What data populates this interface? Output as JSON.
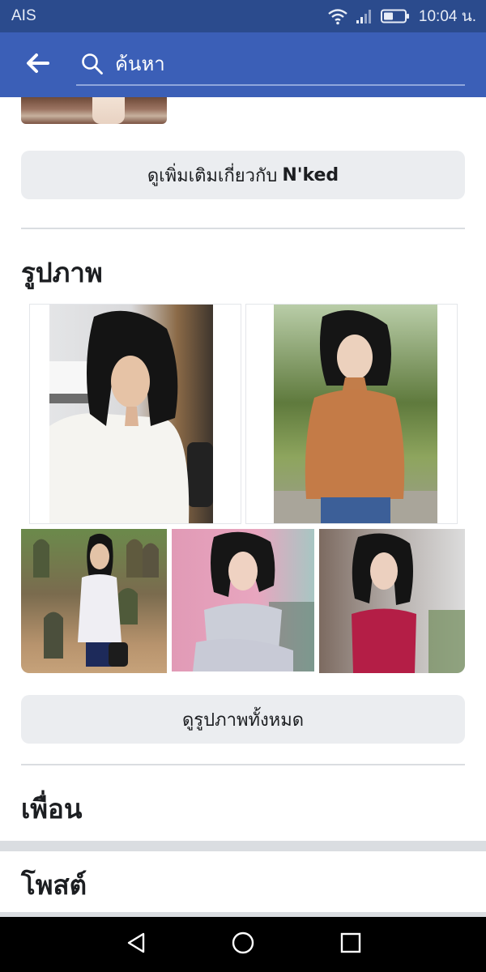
{
  "status_bar": {
    "carrier": "AIS",
    "time": "10:04 น.",
    "wifi_icon": "wifi-icon",
    "signal_icon": "signal-icon",
    "battery_icon": "battery-icon"
  },
  "app_bar": {
    "back_icon": "arrow-left-icon",
    "search_placeholder": "ค้นหา",
    "search_icon": "search-icon",
    "background_color": "#3b5fb7"
  },
  "about": {
    "see_more_prefix": "ดูเพิ่มเติมเกี่ยวกับ",
    "see_more_name": "N'ked"
  },
  "photos": {
    "title": "รูปภาพ",
    "see_all_label": "ดูรูปภาพทั้งหมด",
    "items": [
      "photo-1",
      "photo-2",
      "photo-3",
      "photo-4",
      "photo-5"
    ]
  },
  "friends": {
    "title": "เพื่อน"
  },
  "posts": {
    "title": "โพสต์"
  },
  "nav_bar": {
    "back_icon": "triangle-back-icon",
    "home_icon": "circle-home-icon",
    "recents_icon": "square-recents-icon"
  }
}
